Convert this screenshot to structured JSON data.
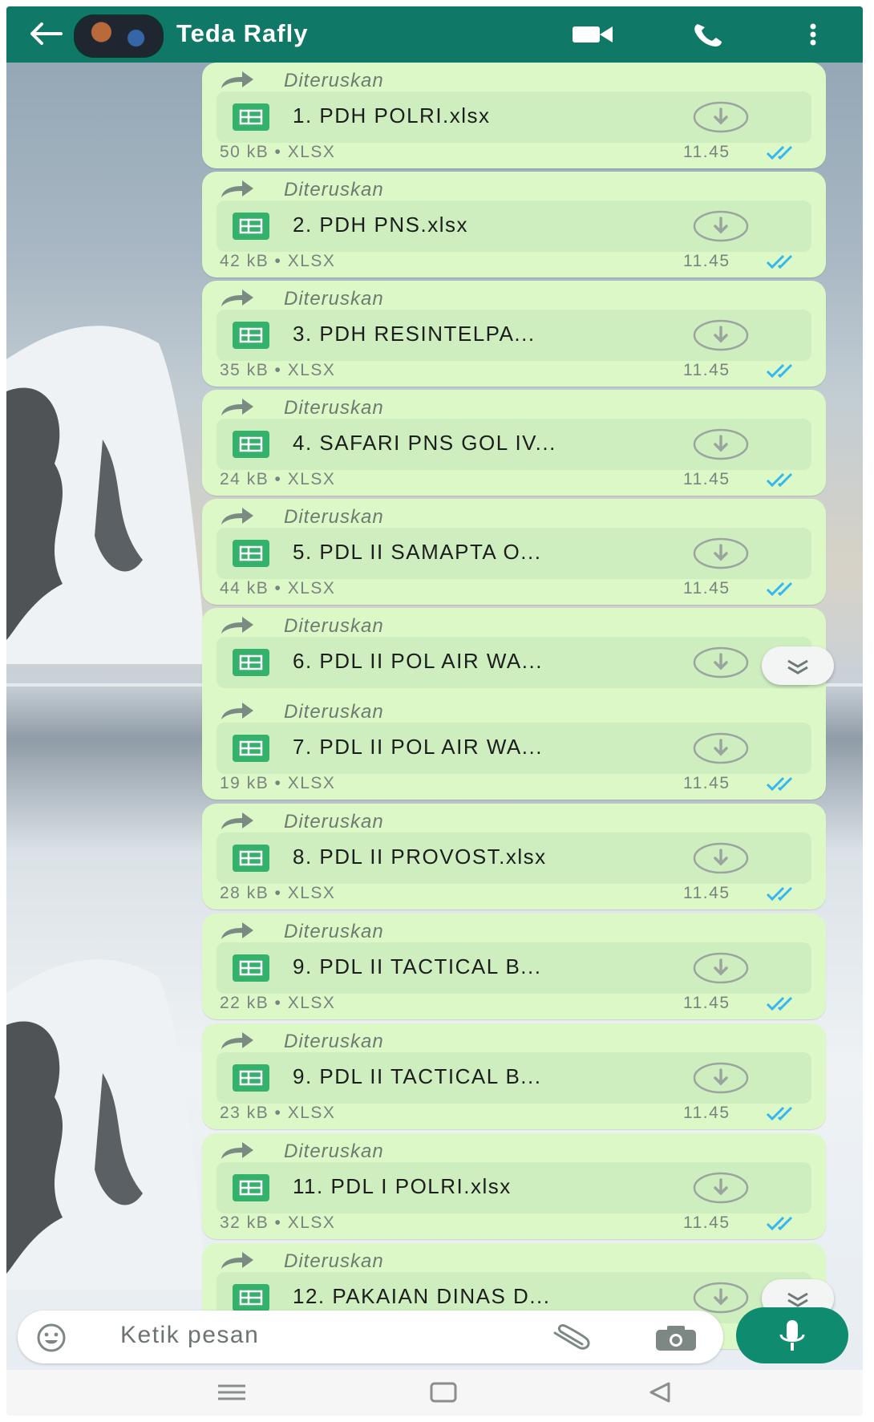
{
  "header": {
    "contact_name": "Teda Rafly",
    "icons": [
      "back-arrow-icon",
      "avatar",
      "video-call-icon",
      "phone-call-icon",
      "more-vert-icon"
    ],
    "color": "#0f7867"
  },
  "forward_label": "Diteruskan",
  "messages": [
    {
      "name": "1. PDH POLRI.xlsx",
      "size": "50 kB",
      "type": "XLSX",
      "time": "11.45"
    },
    {
      "name": "2. PDH PNS.xlsx",
      "size": "42 kB",
      "type": "XLSX",
      "time": "11.45"
    },
    {
      "name": "3. PDH RESINTELPA...",
      "size": "35 kB",
      "type": "XLSX",
      "time": "11.45"
    },
    {
      "name": "4. SAFARI PNS GOL IV...",
      "size": "24 kB",
      "type": "XLSX",
      "time": "11.45"
    },
    {
      "name": "5. PDL II SAMAPTA  O...",
      "size": "44 kB",
      "type": "XLSX",
      "time": "11.45"
    },
    {
      "name": "6. PDL II POL AIR WA...",
      "size": "",
      "type": "",
      "time": ""
    },
    {
      "name": "7. PDL II POL AIR WA...",
      "size": "19 kB",
      "type": "XLSX",
      "time": "11.45"
    },
    {
      "name": "8. PDL II PROVOST.xlsx",
      "size": "28 kB",
      "type": "XLSX",
      "time": "11.45"
    },
    {
      "name": "9. PDL II TACTICAL B...",
      "size": "22 kB",
      "type": "XLSX",
      "time": "11.45"
    },
    {
      "name": "9. PDL II TACTICAL B...",
      "size": "23 kB",
      "type": "XLSX",
      "time": "11.45"
    },
    {
      "name": "11. PDL I POLRI.xlsx",
      "size": "32 kB",
      "type": "XLSX",
      "time": "11.45"
    },
    {
      "name": "12. PAKAIAN DINAS D...",
      "size": "",
      "type": "",
      "time": ""
    }
  ],
  "input": {
    "placeholder": "Ketik pesan",
    "icons": [
      "emoji-icon",
      "attach-icon",
      "camera-icon",
      "mic-icon"
    ]
  },
  "colors": {
    "bubble": "#dcf8c6",
    "file_box": "#cfeec0",
    "sheet_icon": "#34b16a",
    "read_ticks": "#34b7f1",
    "mic_button": "#0f8c6f"
  }
}
